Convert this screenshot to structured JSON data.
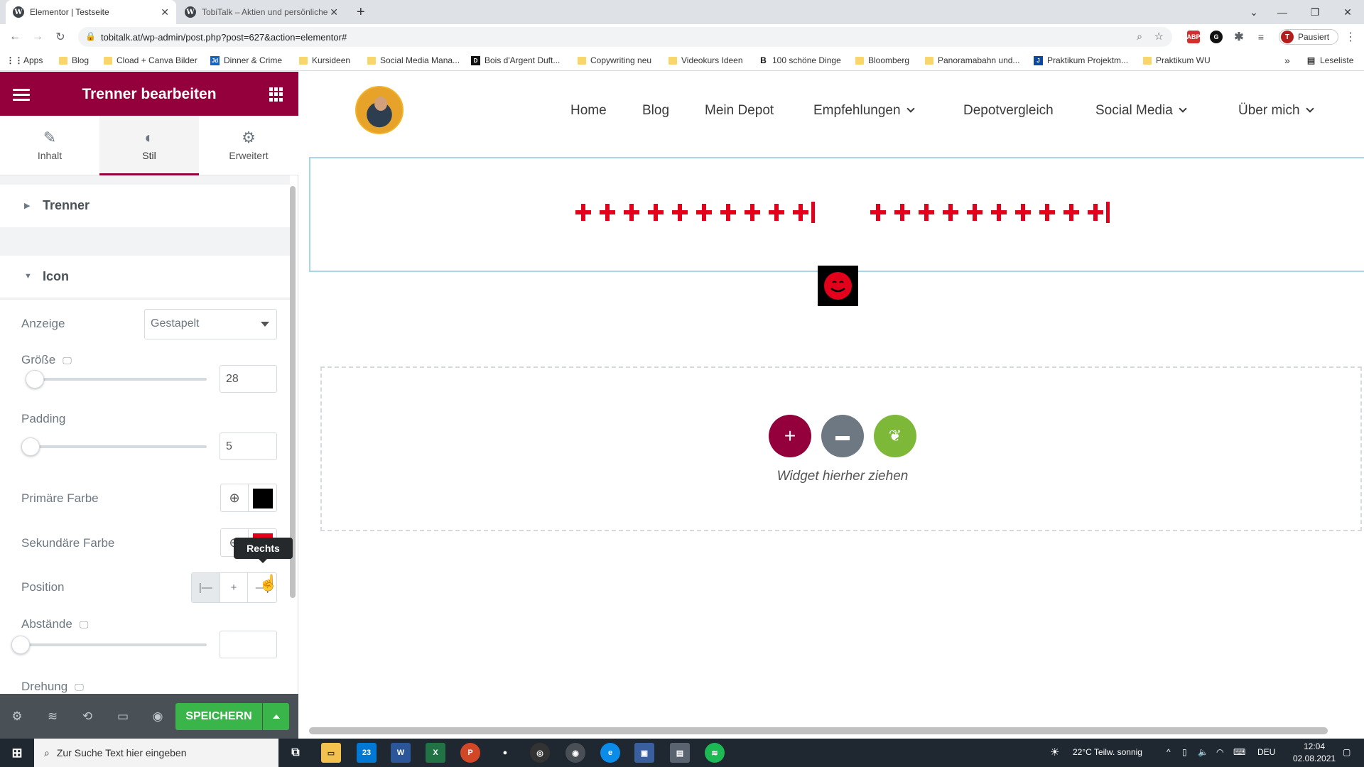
{
  "browser": {
    "tabs": [
      {
        "title": "Elementor | Testseite",
        "active": true
      },
      {
        "title": "TobiTalk – Aktien und persönliche",
        "active": false
      }
    ],
    "new_tab": "+",
    "url": "tobitalk.at/wp-admin/post.php?post=627&action=elementor#",
    "profile_initial": "T",
    "profile_status": "Pausiert",
    "bookmarks": [
      "Apps",
      "Blog",
      "Cload + Canva Bilder",
      "Dinner & Crime",
      "Kursideen",
      "Social Media Mana...",
      "Bois d'Argent Duft...",
      "Copywriting neu",
      "Videokurs Ideen",
      "100 schöne Dinge",
      "Bloomberg",
      "Panoramabahn und...",
      "Praktikum Projektm...",
      "Praktikum WU"
    ],
    "more_bookmarks": "»",
    "reading_list": "Leseliste"
  },
  "panel": {
    "title": "Trenner bearbeiten",
    "tabs": [
      {
        "label": "Inhalt",
        "icon": "pencil-icon"
      },
      {
        "label": "Stil",
        "icon": "contrast-icon"
      },
      {
        "label": "Erweitert",
        "icon": "gear-icon"
      }
    ],
    "sections": {
      "trenner": "Trenner",
      "icon": "Icon"
    },
    "controls": {
      "anzeige_label": "Anzeige",
      "anzeige_value": "Gestapelt",
      "groesse_label": "Größe",
      "groesse_value": "28",
      "padding_label": "Padding",
      "padding_value": "5",
      "primary_color_label": "Primäre Farbe",
      "primary_color": "#000000",
      "secondary_color_label": "Sekundäre Farbe",
      "secondary_color": "#e3001b",
      "position_label": "Position",
      "tooltip": "Rechts",
      "abstaende_label": "Abstände",
      "abstaende_value": "",
      "drehung_label": "Drehung"
    },
    "footer": {
      "save_label": "SPEICHERN"
    }
  },
  "site": {
    "nav": [
      {
        "label": "Home",
        "dropdown": false
      },
      {
        "label": "Blog",
        "dropdown": false
      },
      {
        "label": "Mein Depot",
        "dropdown": false
      },
      {
        "label": "Empfehlungen",
        "dropdown": true
      },
      {
        "label": "Depotvergleich",
        "dropdown": false
      },
      {
        "label": "Social Media",
        "dropdown": true
      },
      {
        "label": "Über mich",
        "dropdown": true
      }
    ],
    "drop_zone_text": "Widget hierher ziehen"
  },
  "taskbar": {
    "search_placeholder": "Zur Suche Text hier eingeben",
    "mail_badge": "23",
    "weather": "22°C  Teilw. sonnig",
    "language": "DEU",
    "time": "12:04",
    "date": "02.08.2021"
  },
  "colors": {
    "elementor_brand": "#93003c",
    "save_green": "#39b54a",
    "divider_red": "#e3001b",
    "library_grey": "#6d7882",
    "template_green": "#7eb839"
  }
}
